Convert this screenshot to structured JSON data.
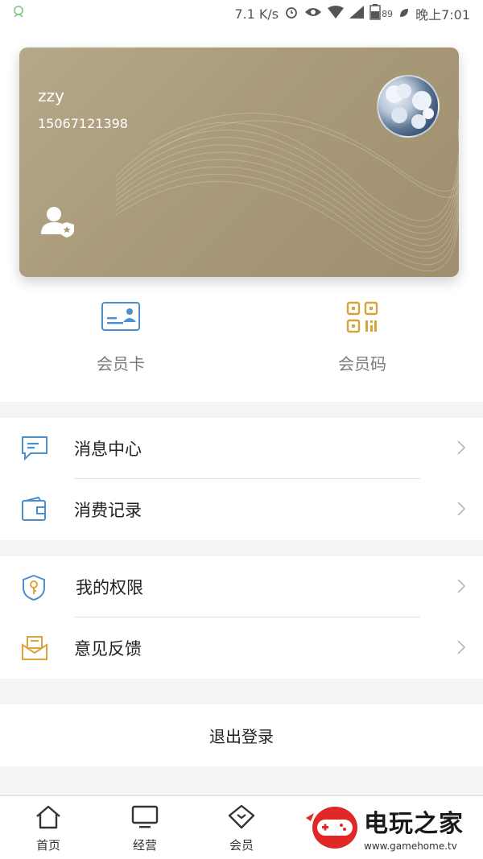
{
  "status_bar": {
    "speed": "7.1 K/s",
    "battery": "89",
    "time": "晚上7:01",
    "icons": [
      "notification-icon",
      "alarm-icon",
      "eye-icon",
      "wifi-icon",
      "signal-icon",
      "battery-icon",
      "leaf-icon"
    ]
  },
  "card": {
    "name": "zzy",
    "phone": "15067121398",
    "colors": {
      "gold": "#a99a79"
    }
  },
  "quick_actions": [
    {
      "label": "会员卡",
      "icon": "member-card-icon"
    },
    {
      "label": "会员码",
      "icon": "qr-code-icon"
    }
  ],
  "menu": {
    "group1": [
      {
        "label": "消息中心",
        "icon": "message-icon"
      },
      {
        "label": "消费记录",
        "icon": "wallet-icon"
      }
    ],
    "group2": [
      {
        "label": "我的权限",
        "icon": "shield-key-icon"
      },
      {
        "label": "意见反馈",
        "icon": "feedback-mail-icon"
      }
    ]
  },
  "logout_label": "退出登录",
  "bottom_nav": [
    {
      "label": "首页",
      "icon": "home-icon"
    },
    {
      "label": "经营",
      "icon": "monitor-icon"
    },
    {
      "label": "会员",
      "icon": "diamond-icon"
    }
  ],
  "watermark": {
    "title": "电玩之家",
    "url": "www.gamehome.tv"
  }
}
